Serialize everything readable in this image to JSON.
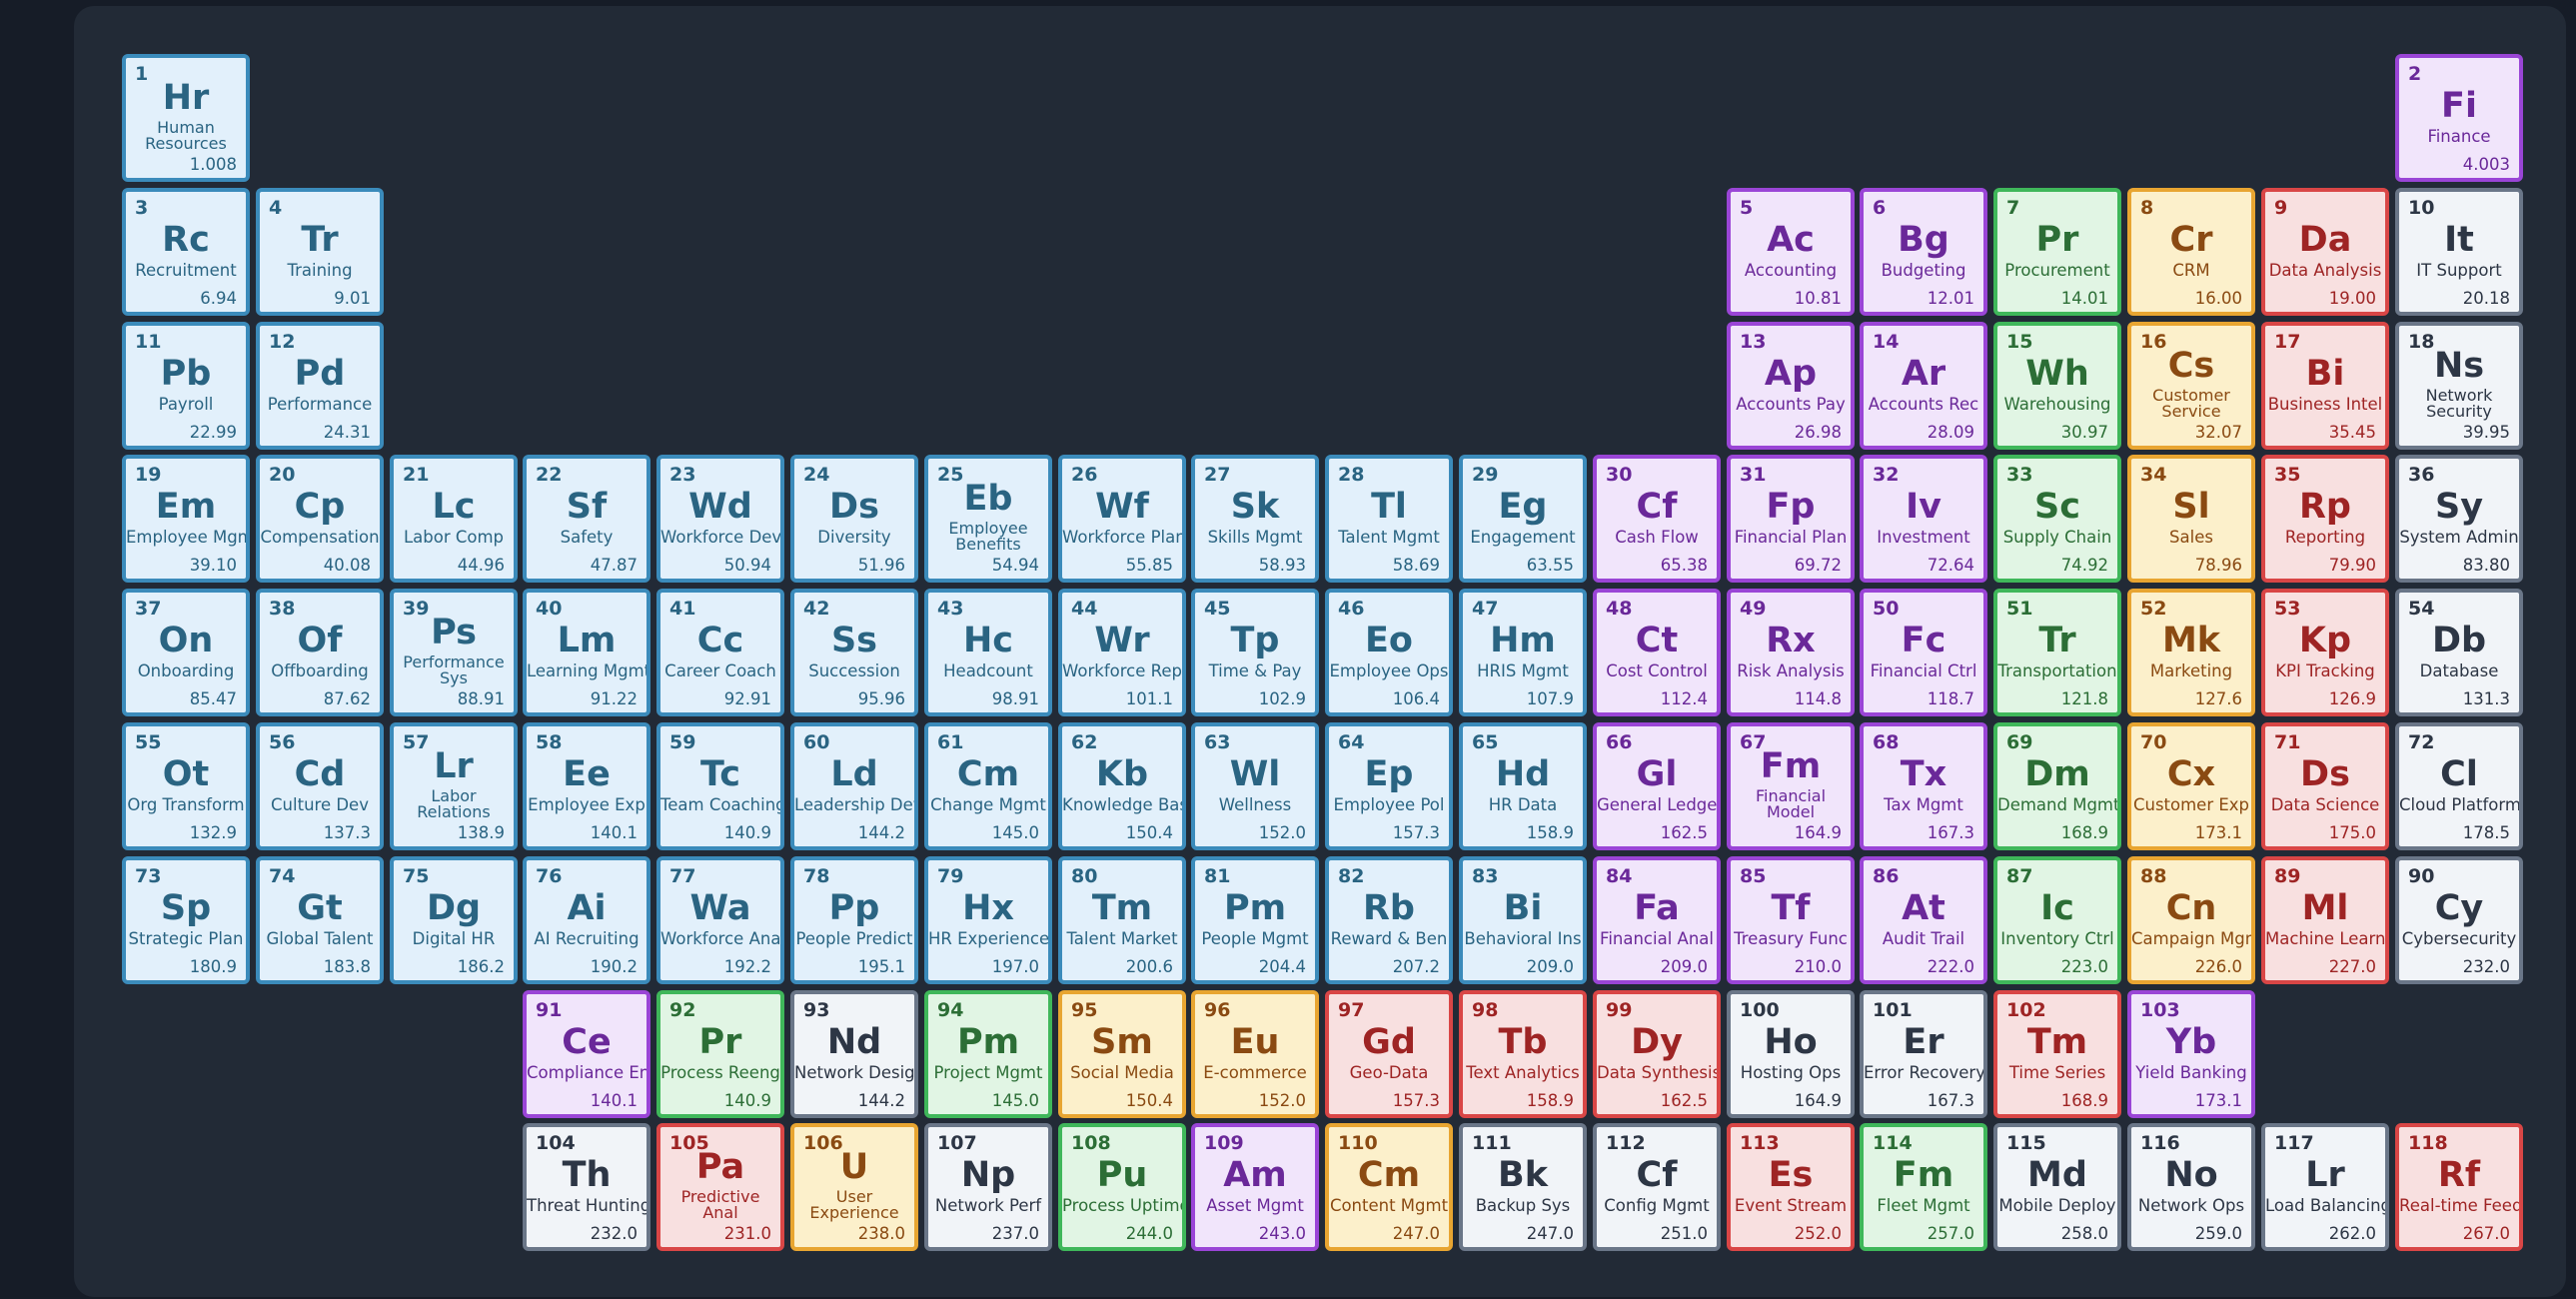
{
  "colors": {
    "page_bg": "#161c27",
    "panel_bg": "#222a36",
    "blue": {
      "bg": "#e2f0fb",
      "border": "#3b8bbb",
      "text": "#2a6482"
    },
    "purple": {
      "bg": "#f1e5fb",
      "border": "#9a45d6",
      "text": "#6a2899"
    },
    "green": {
      "bg": "#e1f5e4",
      "border": "#3fb75a",
      "text": "#2c6e36"
    },
    "orange": {
      "bg": "#fcf0cb",
      "border": "#e8a531",
      "text": "#8a4a12"
    },
    "red": {
      "bg": "#f8e0e0",
      "border": "#d94646",
      "text": "#9e2424"
    },
    "gray": {
      "bg": "#f1f4f8",
      "border": "#6a7688",
      "text": "#2d3645"
    }
  },
  "elements": [
    {
      "n": "1",
      "s": "Hr",
      "name": "Human Resources",
      "m": "1.008",
      "c": "blue",
      "row": 1,
      "col": 1
    },
    {
      "n": "2",
      "s": "Fi",
      "name": "Finance",
      "m": "4.003",
      "c": "purple",
      "row": 1,
      "col": 18
    },
    {
      "n": "3",
      "s": "Rc",
      "name": "Recruitment",
      "m": "6.94",
      "c": "blue",
      "row": 2,
      "col": 1
    },
    {
      "n": "4",
      "s": "Tr",
      "name": "Training",
      "m": "9.01",
      "c": "blue",
      "row": 2,
      "col": 2
    },
    {
      "n": "5",
      "s": "Ac",
      "name": "Accounting",
      "m": "10.81",
      "c": "purple",
      "row": 2,
      "col": 13
    },
    {
      "n": "6",
      "s": "Bg",
      "name": "Budgeting",
      "m": "12.01",
      "c": "purple",
      "row": 2,
      "col": 14
    },
    {
      "n": "7",
      "s": "Pr",
      "name": "Procurement",
      "m": "14.01",
      "c": "green",
      "row": 2,
      "col": 15
    },
    {
      "n": "8",
      "s": "Cr",
      "name": "CRM",
      "m": "16.00",
      "c": "orange",
      "row": 2,
      "col": 16
    },
    {
      "n": "9",
      "s": "Da",
      "name": "Data Analysis",
      "m": "19.00",
      "c": "red",
      "row": 2,
      "col": 17
    },
    {
      "n": "10",
      "s": "It",
      "name": "IT Support",
      "m": "20.18",
      "c": "gray",
      "row": 2,
      "col": 18
    },
    {
      "n": "11",
      "s": "Pb",
      "name": "Payroll",
      "m": "22.99",
      "c": "blue",
      "row": 3,
      "col": 1
    },
    {
      "n": "12",
      "s": "Pd",
      "name": "Performance",
      "m": "24.31",
      "c": "blue",
      "row": 3,
      "col": 2
    },
    {
      "n": "13",
      "s": "Ap",
      "name": "Accounts Pay",
      "m": "26.98",
      "c": "purple",
      "row": 3,
      "col": 13
    },
    {
      "n": "14",
      "s": "Ar",
      "name": "Accounts Rec",
      "m": "28.09",
      "c": "purple",
      "row": 3,
      "col": 14
    },
    {
      "n": "15",
      "s": "Wh",
      "name": "Warehousing",
      "m": "30.97",
      "c": "green",
      "row": 3,
      "col": 15
    },
    {
      "n": "16",
      "s": "Cs",
      "name": "Customer Service",
      "m": "32.07",
      "c": "orange",
      "row": 3,
      "col": 16
    },
    {
      "n": "17",
      "s": "Bi",
      "name": "Business Intel",
      "m": "35.45",
      "c": "red",
      "row": 3,
      "col": 17
    },
    {
      "n": "18",
      "s": "Ns",
      "name": "Network Security",
      "m": "39.95",
      "c": "gray",
      "row": 3,
      "col": 18
    },
    {
      "n": "19",
      "s": "Em",
      "name": "Employee Mgmt",
      "m": "39.10",
      "c": "blue",
      "row": 4,
      "col": 1
    },
    {
      "n": "20",
      "s": "Cp",
      "name": "Compensation",
      "m": "40.08",
      "c": "blue",
      "row": 4,
      "col": 2
    },
    {
      "n": "21",
      "s": "Lc",
      "name": "Labor Comp",
      "m": "44.96",
      "c": "blue",
      "row": 4,
      "col": 3
    },
    {
      "n": "22",
      "s": "Sf",
      "name": "Safety",
      "m": "47.87",
      "c": "blue",
      "row": 4,
      "col": 4
    },
    {
      "n": "23",
      "s": "Wd",
      "name": "Workforce Dev",
      "m": "50.94",
      "c": "blue",
      "row": 4,
      "col": 5
    },
    {
      "n": "24",
      "s": "Ds",
      "name": "Diversity",
      "m": "51.96",
      "c": "blue",
      "row": 4,
      "col": 6
    },
    {
      "n": "25",
      "s": "Eb",
      "name": "Employee Benefits",
      "m": "54.94",
      "c": "blue",
      "row": 4,
      "col": 7
    },
    {
      "n": "26",
      "s": "Wf",
      "name": "Workforce Plan",
      "m": "55.85",
      "c": "blue",
      "row": 4,
      "col": 8
    },
    {
      "n": "27",
      "s": "Sk",
      "name": "Skills Mgmt",
      "m": "58.93",
      "c": "blue",
      "row": 4,
      "col": 9
    },
    {
      "n": "28",
      "s": "Tl",
      "name": "Talent Mgmt",
      "m": "58.69",
      "c": "blue",
      "row": 4,
      "col": 10
    },
    {
      "n": "29",
      "s": "Eg",
      "name": "Engagement",
      "m": "63.55",
      "c": "blue",
      "row": 4,
      "col": 11
    },
    {
      "n": "30",
      "s": "Cf",
      "name": "Cash Flow",
      "m": "65.38",
      "c": "purple",
      "row": 4,
      "col": 12
    },
    {
      "n": "31",
      "s": "Fp",
      "name": "Financial Plan",
      "m": "69.72",
      "c": "purple",
      "row": 4,
      "col": 13
    },
    {
      "n": "32",
      "s": "Iv",
      "name": "Investment",
      "m": "72.64",
      "c": "purple",
      "row": 4,
      "col": 14
    },
    {
      "n": "33",
      "s": "Sc",
      "name": "Supply Chain",
      "m": "74.92",
      "c": "green",
      "row": 4,
      "col": 15
    },
    {
      "n": "34",
      "s": "Sl",
      "name": "Sales",
      "m": "78.96",
      "c": "orange",
      "row": 4,
      "col": 16
    },
    {
      "n": "35",
      "s": "Rp",
      "name": "Reporting",
      "m": "79.90",
      "c": "red",
      "row": 4,
      "col": 17
    },
    {
      "n": "36",
      "s": "Sy",
      "name": "System Admin",
      "m": "83.80",
      "c": "gray",
      "row": 4,
      "col": 18
    },
    {
      "n": "37",
      "s": "On",
      "name": "Onboarding",
      "m": "85.47",
      "c": "blue",
      "row": 5,
      "col": 1
    },
    {
      "n": "38",
      "s": "Of",
      "name": "Offboarding",
      "m": "87.62",
      "c": "blue",
      "row": 5,
      "col": 2
    },
    {
      "n": "39",
      "s": "Ps",
      "name": "Performance Sys",
      "m": "88.91",
      "c": "blue",
      "row": 5,
      "col": 3
    },
    {
      "n": "40",
      "s": "Lm",
      "name": "Learning Mgmt",
      "m": "91.22",
      "c": "blue",
      "row": 5,
      "col": 4
    },
    {
      "n": "41",
      "s": "Cc",
      "name": "Career Coach",
      "m": "92.91",
      "c": "blue",
      "row": 5,
      "col": 5
    },
    {
      "n": "42",
      "s": "Ss",
      "name": "Succession",
      "m": "95.96",
      "c": "blue",
      "row": 5,
      "col": 6
    },
    {
      "n": "43",
      "s": "Hc",
      "name": "Headcount",
      "m": "98.91",
      "c": "blue",
      "row": 5,
      "col": 7
    },
    {
      "n": "44",
      "s": "Wr",
      "name": "Workforce Rep",
      "m": "101.1",
      "c": "blue",
      "row": 5,
      "col": 8
    },
    {
      "n": "45",
      "s": "Tp",
      "name": "Time & Pay",
      "m": "102.9",
      "c": "blue",
      "row": 5,
      "col": 9
    },
    {
      "n": "46",
      "s": "Eo",
      "name": "Employee Ops",
      "m": "106.4",
      "c": "blue",
      "row": 5,
      "col": 10
    },
    {
      "n": "47",
      "s": "Hm",
      "name": "HRIS Mgmt",
      "m": "107.9",
      "c": "blue",
      "row": 5,
      "col": 11
    },
    {
      "n": "48",
      "s": "Ct",
      "name": "Cost Control",
      "m": "112.4",
      "c": "purple",
      "row": 5,
      "col": 12
    },
    {
      "n": "49",
      "s": "Rx",
      "name": "Risk Analysis",
      "m": "114.8",
      "c": "purple",
      "row": 5,
      "col": 13
    },
    {
      "n": "50",
      "s": "Fc",
      "name": "Financial Ctrl",
      "m": "118.7",
      "c": "purple",
      "row": 5,
      "col": 14
    },
    {
      "n": "51",
      "s": "Tr",
      "name": "Transportation",
      "m": "121.8",
      "c": "green",
      "row": 5,
      "col": 15
    },
    {
      "n": "52",
      "s": "Mk",
      "name": "Marketing",
      "m": "127.6",
      "c": "orange",
      "row": 5,
      "col": 16
    },
    {
      "n": "53",
      "s": "Kp",
      "name": "KPI Tracking",
      "m": "126.9",
      "c": "red",
      "row": 5,
      "col": 17
    },
    {
      "n": "54",
      "s": "Db",
      "name": "Database",
      "m": "131.3",
      "c": "gray",
      "row": 5,
      "col": 18
    },
    {
      "n": "55",
      "s": "Ot",
      "name": "Org Transform",
      "m": "132.9",
      "c": "blue",
      "row": 6,
      "col": 1
    },
    {
      "n": "56",
      "s": "Cd",
      "name": "Culture Dev",
      "m": "137.3",
      "c": "blue",
      "row": 6,
      "col": 2
    },
    {
      "n": "57",
      "s": "Lr",
      "name": "Labor Relations",
      "m": "138.9",
      "c": "blue",
      "row": 6,
      "col": 3
    },
    {
      "n": "58",
      "s": "Ee",
      "name": "Employee Exp",
      "m": "140.1",
      "c": "blue",
      "row": 6,
      "col": 4
    },
    {
      "n": "59",
      "s": "Tc",
      "name": "Team Coaching",
      "m": "140.9",
      "c": "blue",
      "row": 6,
      "col": 5
    },
    {
      "n": "60",
      "s": "Ld",
      "name": "Leadership Dev",
      "m": "144.2",
      "c": "blue",
      "row": 6,
      "col": 6
    },
    {
      "n": "61",
      "s": "Cm",
      "name": "Change Mgmt",
      "m": "145.0",
      "c": "blue",
      "row": 6,
      "col": 7
    },
    {
      "n": "62",
      "s": "Kb",
      "name": "Knowledge Base",
      "m": "150.4",
      "c": "blue",
      "row": 6,
      "col": 8
    },
    {
      "n": "63",
      "s": "Wl",
      "name": "Wellness",
      "m": "152.0",
      "c": "blue",
      "row": 6,
      "col": 9
    },
    {
      "n": "64",
      "s": "Ep",
      "name": "Employee Pol",
      "m": "157.3",
      "c": "blue",
      "row": 6,
      "col": 10
    },
    {
      "n": "65",
      "s": "Hd",
      "name": "HR Data",
      "m": "158.9",
      "c": "blue",
      "row": 6,
      "col": 11
    },
    {
      "n": "66",
      "s": "Gl",
      "name": "General Ledger",
      "m": "162.5",
      "c": "purple",
      "row": 6,
      "col": 12
    },
    {
      "n": "67",
      "s": "Fm",
      "name": "Financial Model",
      "m": "164.9",
      "c": "purple",
      "row": 6,
      "col": 13
    },
    {
      "n": "68",
      "s": "Tx",
      "name": "Tax Mgmt",
      "m": "167.3",
      "c": "purple",
      "row": 6,
      "col": 14
    },
    {
      "n": "69",
      "s": "Dm",
      "name": "Demand Mgmt",
      "m": "168.9",
      "c": "green",
      "row": 6,
      "col": 15
    },
    {
      "n": "70",
      "s": "Cx",
      "name": "Customer Exp",
      "m": "173.1",
      "c": "orange",
      "row": 6,
      "col": 16
    },
    {
      "n": "71",
      "s": "Ds",
      "name": "Data Science",
      "m": "175.0",
      "c": "red",
      "row": 6,
      "col": 17
    },
    {
      "n": "72",
      "s": "Cl",
      "name": "Cloud Platform",
      "m": "178.5",
      "c": "gray",
      "row": 6,
      "col": 18
    },
    {
      "n": "73",
      "s": "Sp",
      "name": "Strategic Plan",
      "m": "180.9",
      "c": "blue",
      "row": 7,
      "col": 1
    },
    {
      "n": "74",
      "s": "Gt",
      "name": "Global Talent",
      "m": "183.8",
      "c": "blue",
      "row": 7,
      "col": 2
    },
    {
      "n": "75",
      "s": "Dg",
      "name": "Digital HR",
      "m": "186.2",
      "c": "blue",
      "row": 7,
      "col": 3
    },
    {
      "n": "76",
      "s": "Ai",
      "name": "AI Recruiting",
      "m": "190.2",
      "c": "blue",
      "row": 7,
      "col": 4
    },
    {
      "n": "77",
      "s": "Wa",
      "name": "Workforce Anal",
      "m": "192.2",
      "c": "blue",
      "row": 7,
      "col": 5
    },
    {
      "n": "78",
      "s": "Pp",
      "name": "People Predict",
      "m": "195.1",
      "c": "blue",
      "row": 7,
      "col": 6
    },
    {
      "n": "79",
      "s": "Hx",
      "name": "HR Experience",
      "m": "197.0",
      "c": "blue",
      "row": 7,
      "col": 7
    },
    {
      "n": "80",
      "s": "Tm",
      "name": "Talent Market",
      "m": "200.6",
      "c": "blue",
      "row": 7,
      "col": 8
    },
    {
      "n": "81",
      "s": "Pm",
      "name": "People Mgmt",
      "m": "204.4",
      "c": "blue",
      "row": 7,
      "col": 9
    },
    {
      "n": "82",
      "s": "Rb",
      "name": "Reward & Ben",
      "m": "207.2",
      "c": "blue",
      "row": 7,
      "col": 10
    },
    {
      "n": "83",
      "s": "Bi",
      "name": "Behavioral Ins",
      "m": "209.0",
      "c": "blue",
      "row": 7,
      "col": 11
    },
    {
      "n": "84",
      "s": "Fa",
      "name": "Financial Anal",
      "m": "209.0",
      "c": "purple",
      "row": 7,
      "col": 12
    },
    {
      "n": "85",
      "s": "Tf",
      "name": "Treasury Func",
      "m": "210.0",
      "c": "purple",
      "row": 7,
      "col": 13
    },
    {
      "n": "86",
      "s": "At",
      "name": "Audit Trail",
      "m": "222.0",
      "c": "purple",
      "row": 7,
      "col": 14
    },
    {
      "n": "87",
      "s": "Ic",
      "name": "Inventory Ctrl",
      "m": "223.0",
      "c": "green",
      "row": 7,
      "col": 15
    },
    {
      "n": "88",
      "s": "Cn",
      "name": "Campaign Mgmt",
      "m": "226.0",
      "c": "orange",
      "row": 7,
      "col": 16
    },
    {
      "n": "89",
      "s": "Ml",
      "name": "Machine Learn",
      "m": "227.0",
      "c": "red",
      "row": 7,
      "col": 17
    },
    {
      "n": "90",
      "s": "Cy",
      "name": "Cybersecurity",
      "m": "232.0",
      "c": "gray",
      "row": 7,
      "col": 18
    },
    {
      "n": "91",
      "s": "Ce",
      "name": "Compliance Eng",
      "m": "140.1",
      "c": "purple",
      "row": 8,
      "col": 4
    },
    {
      "n": "92",
      "s": "Pr",
      "name": "Process Reeng",
      "m": "140.9",
      "c": "green",
      "row": 8,
      "col": 5
    },
    {
      "n": "93",
      "s": "Nd",
      "name": "Network Design",
      "m": "144.2",
      "c": "gray",
      "row": 8,
      "col": 6
    },
    {
      "n": "94",
      "s": "Pm",
      "name": "Project Mgmt",
      "m": "145.0",
      "c": "green",
      "row": 8,
      "col": 7
    },
    {
      "n": "95",
      "s": "Sm",
      "name": "Social Media",
      "m": "150.4",
      "c": "orange",
      "row": 8,
      "col": 8
    },
    {
      "n": "96",
      "s": "Eu",
      "name": "E-commerce",
      "m": "152.0",
      "c": "orange",
      "row": 8,
      "col": 9
    },
    {
      "n": "97",
      "s": "Gd",
      "name": "Geo-Data",
      "m": "157.3",
      "c": "red",
      "row": 8,
      "col": 10
    },
    {
      "n": "98",
      "s": "Tb",
      "name": "Text Analytics",
      "m": "158.9",
      "c": "red",
      "row": 8,
      "col": 11
    },
    {
      "n": "99",
      "s": "Dy",
      "name": "Data Synthesis",
      "m": "162.5",
      "c": "red",
      "row": 8,
      "col": 12
    },
    {
      "n": "100",
      "s": "Ho",
      "name": "Hosting Ops",
      "m": "164.9",
      "c": "gray",
      "row": 8,
      "col": 13
    },
    {
      "n": "101",
      "s": "Er",
      "name": "Error Recovery",
      "m": "167.3",
      "c": "gray",
      "row": 8,
      "col": 14
    },
    {
      "n": "102",
      "s": "Tm",
      "name": "Time Series",
      "m": "168.9",
      "c": "red",
      "row": 8,
      "col": 15
    },
    {
      "n": "103",
      "s": "Yb",
      "name": "Yield Banking",
      "m": "173.1",
      "c": "purple",
      "row": 8,
      "col": 16
    },
    {
      "n": "104",
      "s": "Th",
      "name": "Threat Hunting",
      "m": "232.0",
      "c": "gray",
      "row": 9,
      "col": 4
    },
    {
      "n": "105",
      "s": "Pa",
      "name": "Predictive Anal",
      "m": "231.0",
      "c": "red",
      "row": 9,
      "col": 5
    },
    {
      "n": "106",
      "s": "U",
      "name": "User Experience",
      "m": "238.0",
      "c": "orange",
      "row": 9,
      "col": 6
    },
    {
      "n": "107",
      "s": "Np",
      "name": "Network Perf",
      "m": "237.0",
      "c": "gray",
      "row": 9,
      "col": 7
    },
    {
      "n": "108",
      "s": "Pu",
      "name": "Process Uptime",
      "m": "244.0",
      "c": "green",
      "row": 9,
      "col": 8
    },
    {
      "n": "109",
      "s": "Am",
      "name": "Asset Mgmt",
      "m": "243.0",
      "c": "purple",
      "row": 9,
      "col": 9
    },
    {
      "n": "110",
      "s": "Cm",
      "name": "Content Mgmt",
      "m": "247.0",
      "c": "orange",
      "row": 9,
      "col": 10
    },
    {
      "n": "111",
      "s": "Bk",
      "name": "Backup Sys",
      "m": "247.0",
      "c": "gray",
      "row": 9,
      "col": 11
    },
    {
      "n": "112",
      "s": "Cf",
      "name": "Config Mgmt",
      "m": "251.0",
      "c": "gray",
      "row": 9,
      "col": 12
    },
    {
      "n": "113",
      "s": "Es",
      "name": "Event Stream",
      "m": "252.0",
      "c": "red",
      "row": 9,
      "col": 13
    },
    {
      "n": "114",
      "s": "Fm",
      "name": "Fleet Mgmt",
      "m": "257.0",
      "c": "green",
      "row": 9,
      "col": 14
    },
    {
      "n": "115",
      "s": "Md",
      "name": "Mobile Deploy",
      "m": "258.0",
      "c": "gray",
      "row": 9,
      "col": 15
    },
    {
      "n": "116",
      "s": "No",
      "name": "Network Ops",
      "m": "259.0",
      "c": "gray",
      "row": 9,
      "col": 16
    },
    {
      "n": "117",
      "s": "Lr",
      "name": "Load Balancing",
      "m": "262.0",
      "c": "gray",
      "row": 9,
      "col": 17
    },
    {
      "n": "118",
      "s": "Rf",
      "name": "Real-time Feed",
      "m": "267.0",
      "c": "red",
      "row": 9,
      "col": 18
    }
  ]
}
